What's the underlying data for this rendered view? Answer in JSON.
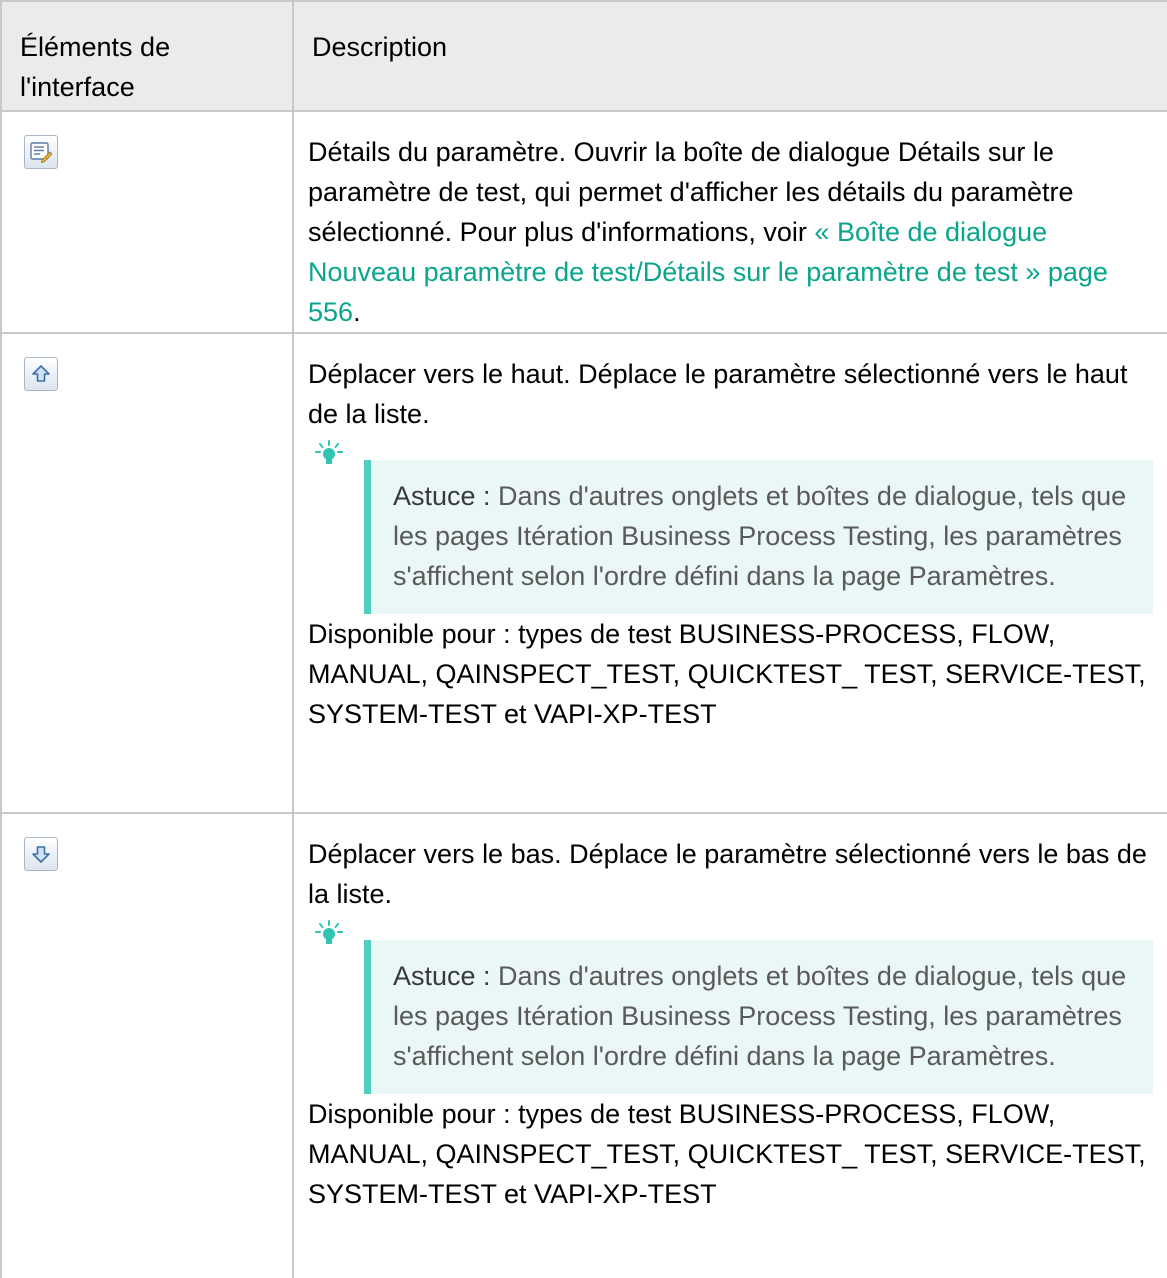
{
  "table": {
    "header": {
      "col1": "Éléments de l'interface",
      "col2": "Description"
    },
    "rows": [
      {
        "icon": "parameter-details-icon",
        "title": "Détails du paramètre.",
        "text": " Ouvrir la boîte de dialogue Détails sur le paramètre de test, qui permet d'afficher les détails du paramètre sélectionné. Pour plus d'informations, voir ",
        "link": "« Boîte de dialogue Nouveau paramètre de test/Détails sur le paramètre de test » page 556",
        "end": "."
      },
      {
        "icon": "move-up-icon",
        "title": "Déplacer vers le haut.",
        "text": " Déplace le paramètre sélectionné vers le haut de la liste.",
        "tip_label": "Astuce :",
        "tip_text": " Dans d'autres onglets et boîtes de dialogue, tels que les pages Itération Business Process Testing, les paramètres s'affichent selon l'ordre défini dans la page Paramètres.",
        "avail_label": "Disponible pour",
        "avail_text": " : types de test BUSINESS-PROCESS, FLOW, MANUAL, QAINSPECT_TEST, QUICKTEST_ TEST, SERVICE-TEST, SYSTEM-TEST et VAPI-XP-TEST"
      },
      {
        "icon": "move-down-icon",
        "title": "Déplacer vers le bas.",
        "text": " Déplace le paramètre sélectionné vers le bas de la liste.",
        "tip_label": "Astuce :",
        "tip_text": " Dans d'autres onglets et boîtes de dialogue, tels que les pages Itération Business Process Testing, les paramètres s'affichent selon l'ordre défini dans la page Paramètres.",
        "avail_label": "Disponible pour",
        "avail_text": " : types de test BUSINESS-PROCESS, FLOW, MANUAL, QAINSPECT_TEST, QUICKTEST_ TEST, SERVICE-TEST, SYSTEM-TEST et VAPI-XP-TEST"
      }
    ]
  },
  "colors": {
    "link": "#0aa58c",
    "tip_border": "#4fcfc1",
    "tip_background": "#e9f8f6",
    "header_background": "#ebebeb"
  }
}
